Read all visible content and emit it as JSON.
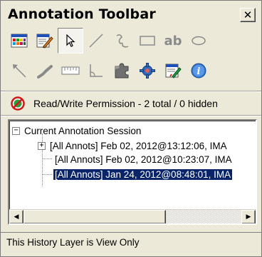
{
  "window": {
    "title": "Annotation Toolbar",
    "close_glyph": "✕"
  },
  "toolbar": {
    "row1": [
      "color-palette-icon",
      "edit-properties-icon",
      "select-arrow-icon",
      "line-icon",
      "freehand-icon",
      "rectangle-icon",
      "text-ab-icon",
      "ellipse-icon"
    ],
    "row2": [
      "arrow-icon",
      "highlighter-icon",
      "ruler-icon",
      "angle-icon",
      "puzzle-icon",
      "gear-icon",
      "edit-icon",
      "info-icon"
    ],
    "text_tool_label": "ab"
  },
  "permission": {
    "icon": "no-entry-icon",
    "text": "Read/Write Permission - 2 total / 0 hidden"
  },
  "tree": {
    "root": {
      "expander": "−",
      "label": "Current Annotation Session"
    },
    "items": [
      {
        "expander": "+",
        "label": "[All Annots] Feb 02, 2012@13:12:06, IMA",
        "selected": false
      },
      {
        "expander": "",
        "label": "[All Annots] Feb 02, 2012@10:23:07, IMA",
        "selected": false
      },
      {
        "expander": "",
        "label": "[All Annots] Jan 24, 2012@08:48:01, IMA",
        "selected": true
      }
    ]
  },
  "scrollbar": {
    "left_glyph": "◀",
    "right_glyph": "▶"
  },
  "status": {
    "text": "This History Layer is View Only"
  },
  "colors": {
    "selection": "#0a246a",
    "window_bg": "#ece9d8"
  }
}
